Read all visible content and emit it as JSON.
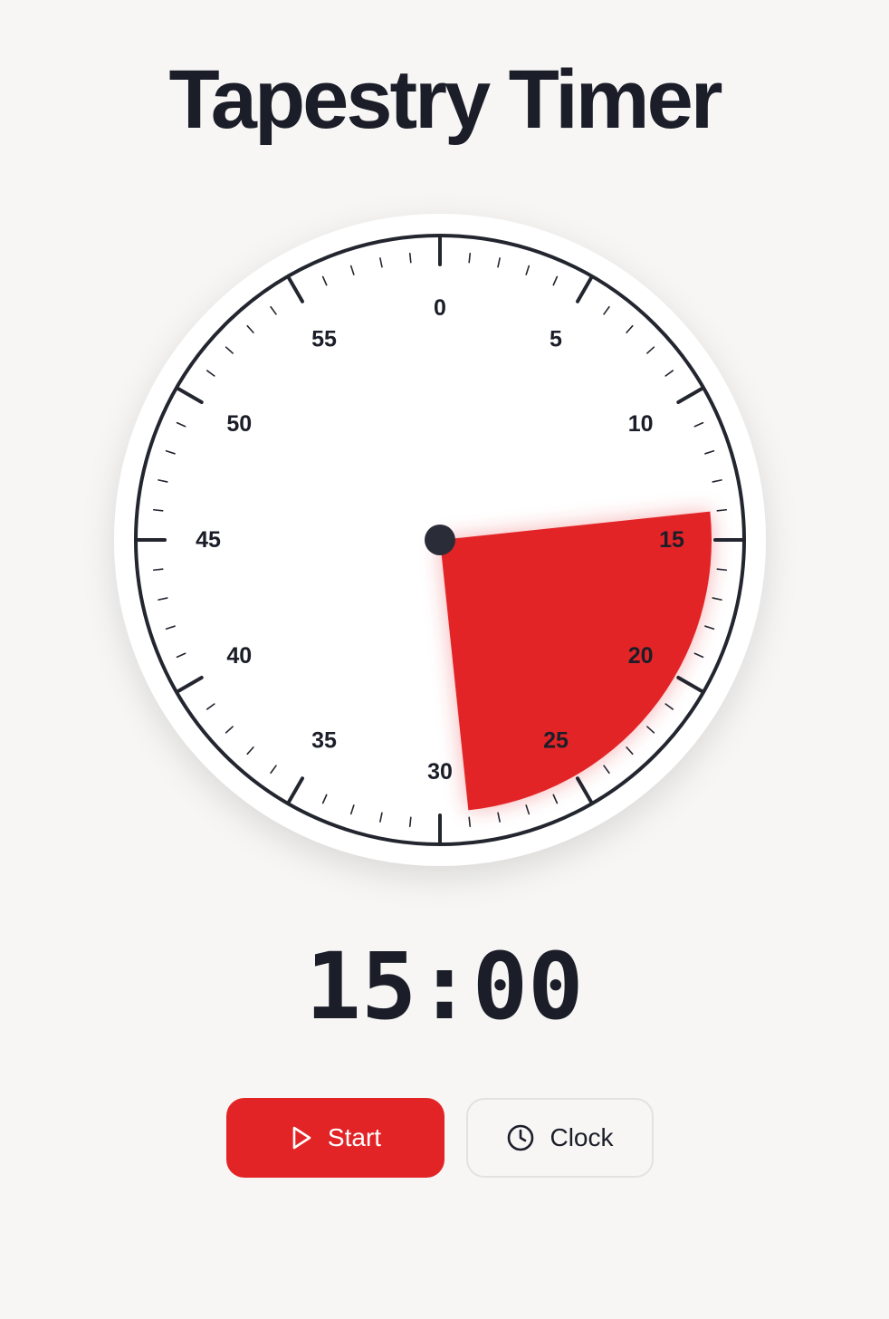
{
  "app": {
    "title": "Tapestry Timer"
  },
  "dial": {
    "labels": [
      "0",
      "5",
      "10",
      "15",
      "20",
      "25",
      "30",
      "35",
      "40",
      "45",
      "50",
      "55"
    ],
    "remaining_minutes": 15,
    "sector_start_minute": 14,
    "sector_end_minute": 29,
    "colors": {
      "sector": "#e32427",
      "rim": "#23252f",
      "face": "#ffffff",
      "hub": "#2a2d38"
    }
  },
  "display": {
    "time": "15:00"
  },
  "controls": {
    "start_label": "Start",
    "start_icon": "play-icon",
    "clock_label": "Clock",
    "clock_icon": "clock-icon"
  }
}
